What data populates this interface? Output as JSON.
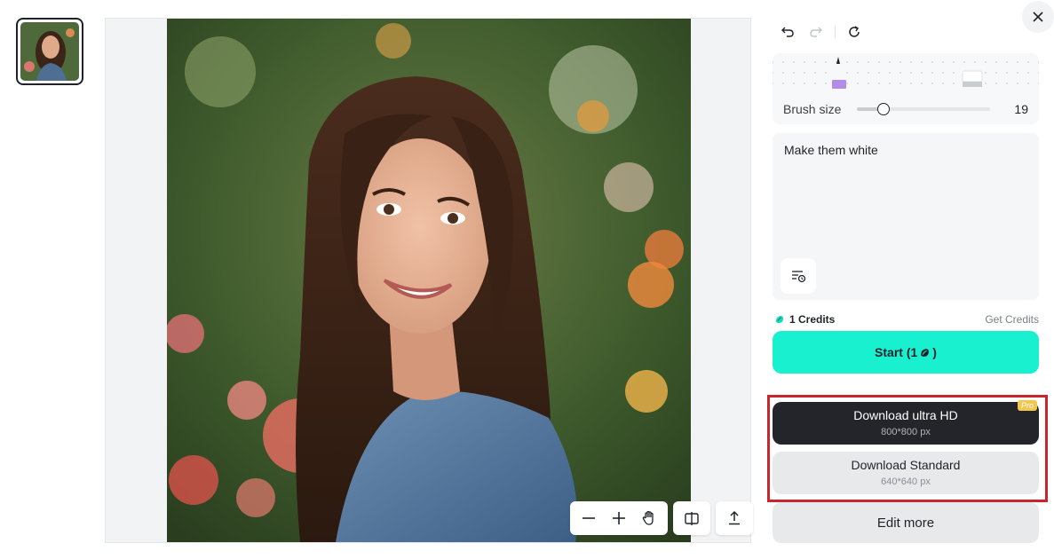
{
  "thumbnail": {
    "alt": "woman-portrait-thumbnail"
  },
  "canvas": {
    "image": "woman-portrait-in-flower-garden"
  },
  "canvas_toolbar": {
    "icons": [
      "minus-icon",
      "plus-icon",
      "hand-icon",
      "compare-icon",
      "export-icon"
    ]
  },
  "history": {
    "icons": [
      "undo-icon",
      "redo-icon",
      "refresh-icon"
    ]
  },
  "brush": {
    "label": "Brush size",
    "value": "19",
    "level": 0.2
  },
  "prompt": {
    "text": "Make them white"
  },
  "credits": {
    "count_label": "1 Credits",
    "get_label": "Get Credits"
  },
  "start": {
    "label": "Start (1",
    "suffix": ")"
  },
  "download_hd": {
    "label": "Download ultra HD",
    "size": "800*800 px",
    "badge": "Pro"
  },
  "download_standard": {
    "label": "Download Standard",
    "size": "640*640 px"
  },
  "edit_more": {
    "label": "Edit more"
  },
  "colors": {
    "accent": "#19f0d0",
    "highlight": "#c8252c",
    "dark_button": "#23252b",
    "badge": "#f3c74e"
  }
}
